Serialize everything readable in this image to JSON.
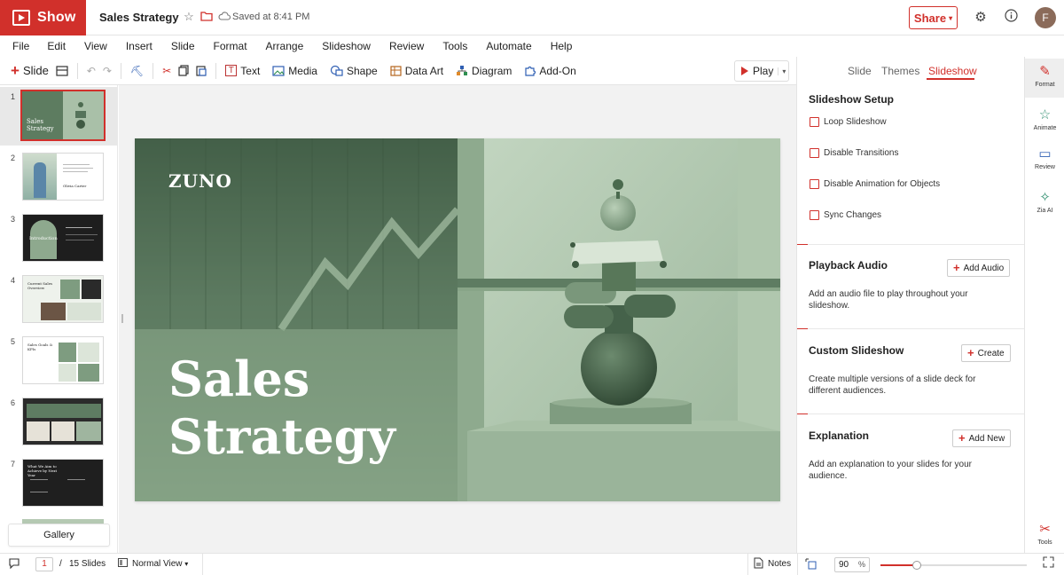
{
  "app": {
    "name": "Show",
    "doc_title": "Sales Strategy",
    "saved_status": "Saved at 8:41 PM",
    "share_label": "Share",
    "avatar_initial": "F",
    "accent": "#d1302b"
  },
  "menu": [
    "File",
    "Edit",
    "View",
    "Insert",
    "Slide",
    "Format",
    "Arrange",
    "Slideshow",
    "Review",
    "Tools",
    "Automate",
    "Help"
  ],
  "toolbar": {
    "slide_label": "Slide",
    "text_label": "Text",
    "media_label": "Media",
    "shape_label": "Shape",
    "data_art_label": "Data Art",
    "diagram_label": "Diagram",
    "addon_label": "Add-On",
    "play_label": "Play"
  },
  "thumbnails": {
    "numbers": [
      "1",
      "2",
      "3",
      "4",
      "5",
      "6",
      "7"
    ],
    "active": "1",
    "t1_title": "Sales Strategy",
    "t2_name": "Olivia Carter",
    "t3_title": "Introduction",
    "t4_title": "Current Sales Overview",
    "t5_title": "Sales Goals & KPIs",
    "t7_title": "What We Aim to Achieve by Next Year",
    "gallery_label": "Gallery"
  },
  "slide": {
    "brand": "ZUNO",
    "title_line1": "Sales",
    "title_line2": "Strategy",
    "bg_color": "#7d9a7e"
  },
  "right_panel": {
    "tabs": [
      "Slide",
      "Themes",
      "Slideshow"
    ],
    "active_tab": "Slideshow",
    "setup_title": "Slideshow Setup",
    "options": [
      {
        "label": "Loop Slideshow",
        "checked": false
      },
      {
        "label": "Disable Transitions",
        "checked": false
      },
      {
        "label": "Disable Animation for Objects",
        "checked": false
      },
      {
        "label": "Sync Changes",
        "checked": false
      }
    ],
    "playback_title": "Playback Audio",
    "playback_button": "Add Audio",
    "playback_desc": "Add an audio file to play throughout your slideshow.",
    "custom_title": "Custom Slideshow",
    "custom_button": "Create",
    "custom_desc": "Create multiple versions of a slide deck for different audiences.",
    "explanation_title": "Explanation",
    "explanation_button": "Add New",
    "explanation_desc": "Add an explanation to your slides for your audience."
  },
  "rail": {
    "items": [
      "Format",
      "Animate",
      "Review",
      "Zia AI"
    ],
    "tools": "Tools",
    "active": "Format"
  },
  "status": {
    "current_page": "1",
    "total_slides": "15 Slides",
    "view_mode": "Normal View",
    "notes_label": "Notes",
    "zoom_value": "90",
    "zoom_unit": "%",
    "zoom_fraction": 0.25
  }
}
